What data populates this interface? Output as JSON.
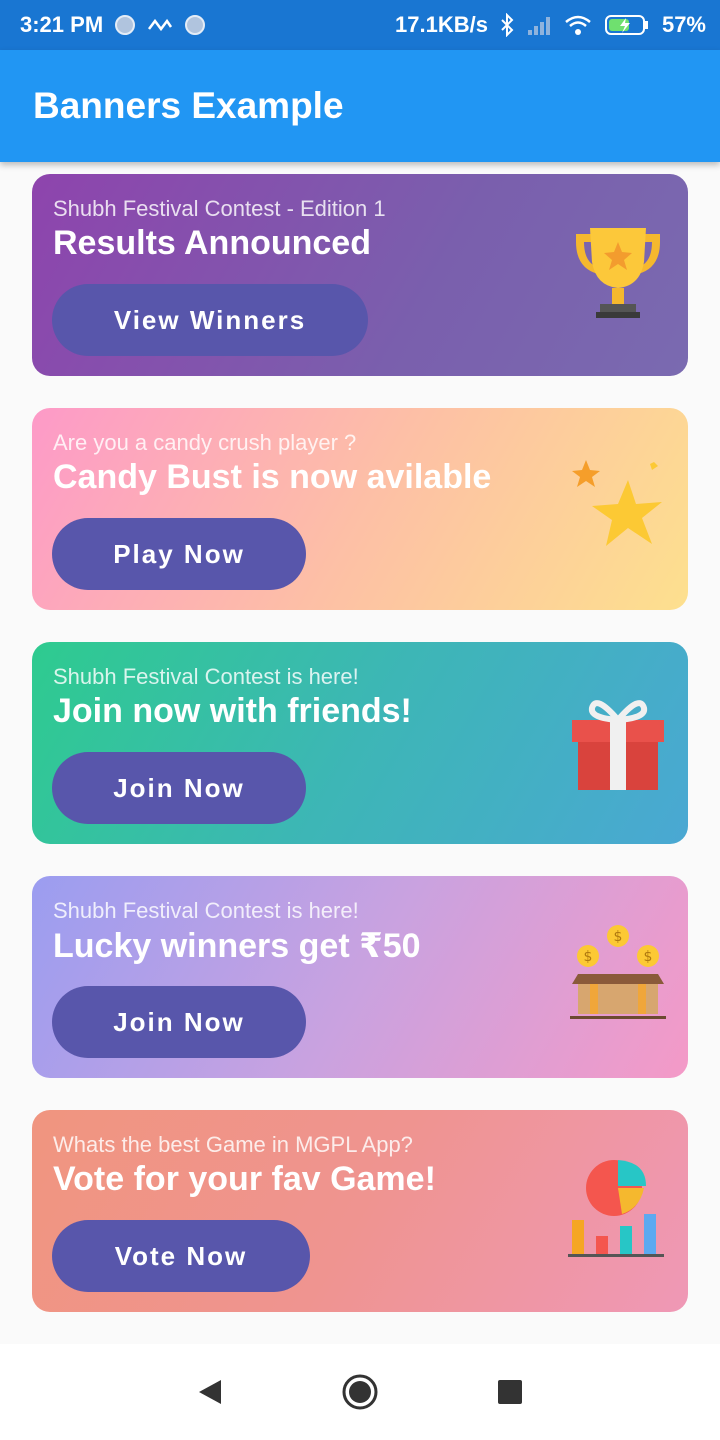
{
  "status_bar": {
    "time": "3:21 PM",
    "net_speed": "17.1KB/s",
    "battery": "57%",
    "icons": [
      "notification-dot-icon",
      "network-icon",
      "notification-dot-icon",
      "bluetooth-icon",
      "signal-icon",
      "wifi-icon",
      "battery-icon"
    ]
  },
  "app_bar": {
    "title": "Banners Example"
  },
  "banners": [
    {
      "subtitle": "Shubh Festival Contest - Edition 1",
      "title": "Results Announced",
      "button": "View Winners",
      "icon": "trophy-icon",
      "gradient": [
        "#8e44ad",
        "#7a6ab0"
      ]
    },
    {
      "subtitle": "Are you a candy crush player ?",
      "title": "Candy Bust is now avilable",
      "button": "Play Now",
      "icon": "stars-icon",
      "gradient": [
        "#fd9ac8",
        "#fde08e"
      ]
    },
    {
      "subtitle": "Shubh Festival Contest is here!",
      "title": "Join now with friends!",
      "button": "Join Now",
      "icon": "gift-icon",
      "gradient": [
        "#2ecb8f",
        "#4aa8d3"
      ]
    },
    {
      "subtitle": "Shubh Festival Contest is here!",
      "title": "Lucky winners get ₹50",
      "button": "Join Now",
      "icon": "treasure-chest-icon",
      "gradient": [
        "#9b9df0",
        "#f49ac7"
      ]
    },
    {
      "subtitle": "Whats the best Game in MGPL App?",
      "title": "Vote for your fav Game!",
      "button": "Vote Now",
      "icon": "chart-icon",
      "gradient": [
        "#f0957f",
        "#ef98b6"
      ]
    }
  ],
  "nav_bar": {
    "icons": [
      "back-icon",
      "home-icon",
      "recents-icon"
    ]
  }
}
